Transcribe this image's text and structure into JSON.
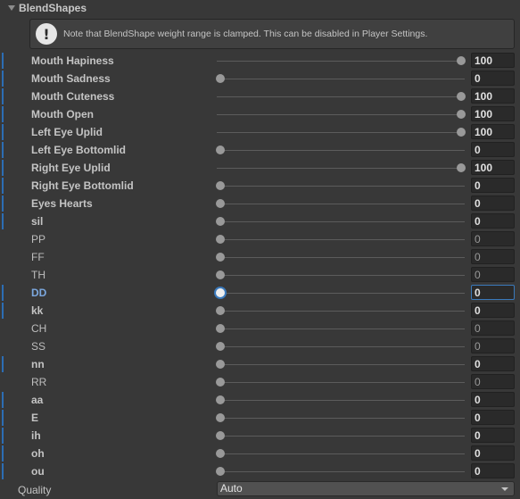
{
  "section": {
    "title": "BlendShapes"
  },
  "help": {
    "icon": "exclamation-icon",
    "text": "Note that BlendShape weight range is clamped. This can be disabled in Player Settings."
  },
  "blendshapes": [
    {
      "label": "Mouth Hapiness",
      "value": "100",
      "weight": 100,
      "overridden": true
    },
    {
      "label": "Mouth Sadness",
      "value": "0",
      "weight": 0,
      "overridden": true
    },
    {
      "label": "Mouth Cuteness",
      "value": "100",
      "weight": 100,
      "overridden": true
    },
    {
      "label": "Mouth Open",
      "value": "100",
      "weight": 100,
      "overridden": true
    },
    {
      "label": "Left Eye Uplid",
      "value": "100",
      "weight": 100,
      "overridden": true
    },
    {
      "label": "Left Eye Bottomlid",
      "value": "0",
      "weight": 0,
      "overridden": true
    },
    {
      "label": "Right Eye Uplid",
      "value": "100",
      "weight": 100,
      "overridden": true
    },
    {
      "label": "Right Eye Bottomlid",
      "value": "0",
      "weight": 0,
      "overridden": true
    },
    {
      "label": "Eyes Hearts",
      "value": "0",
      "weight": 0,
      "overridden": true
    },
    {
      "label": "sil",
      "value": "0",
      "weight": 0,
      "overridden": true
    },
    {
      "label": "PP",
      "value": "0",
      "weight": 0,
      "overridden": false
    },
    {
      "label": "FF",
      "value": "0",
      "weight": 0,
      "overridden": false
    },
    {
      "label": "TH",
      "value": "0",
      "weight": 0,
      "overridden": false
    },
    {
      "label": "DD",
      "value": "0",
      "weight": 0,
      "overridden": true,
      "active": true
    },
    {
      "label": "kk",
      "value": "0",
      "weight": 0,
      "overridden": true
    },
    {
      "label": "CH",
      "value": "0",
      "weight": 0,
      "overridden": false
    },
    {
      "label": "SS",
      "value": "0",
      "weight": 0,
      "overridden": false
    },
    {
      "label": "nn",
      "value": "0",
      "weight": 0,
      "overridden": true
    },
    {
      "label": "RR",
      "value": "0",
      "weight": 0,
      "overridden": false
    },
    {
      "label": "aa",
      "value": "0",
      "weight": 0,
      "overridden": true
    },
    {
      "label": "E",
      "value": "0",
      "weight": 0,
      "overridden": true
    },
    {
      "label": "ih",
      "value": "0",
      "weight": 0,
      "overridden": true
    },
    {
      "label": "oh",
      "value": "0",
      "weight": 0,
      "overridden": true
    },
    {
      "label": "ou",
      "value": "0",
      "weight": 0,
      "overridden": true
    }
  ],
  "quality": {
    "label": "Quality",
    "selected": "Auto"
  },
  "colors": {
    "override_marker": "#2c6db4",
    "active_accent": "#3a79bb",
    "background": "#383838"
  }
}
